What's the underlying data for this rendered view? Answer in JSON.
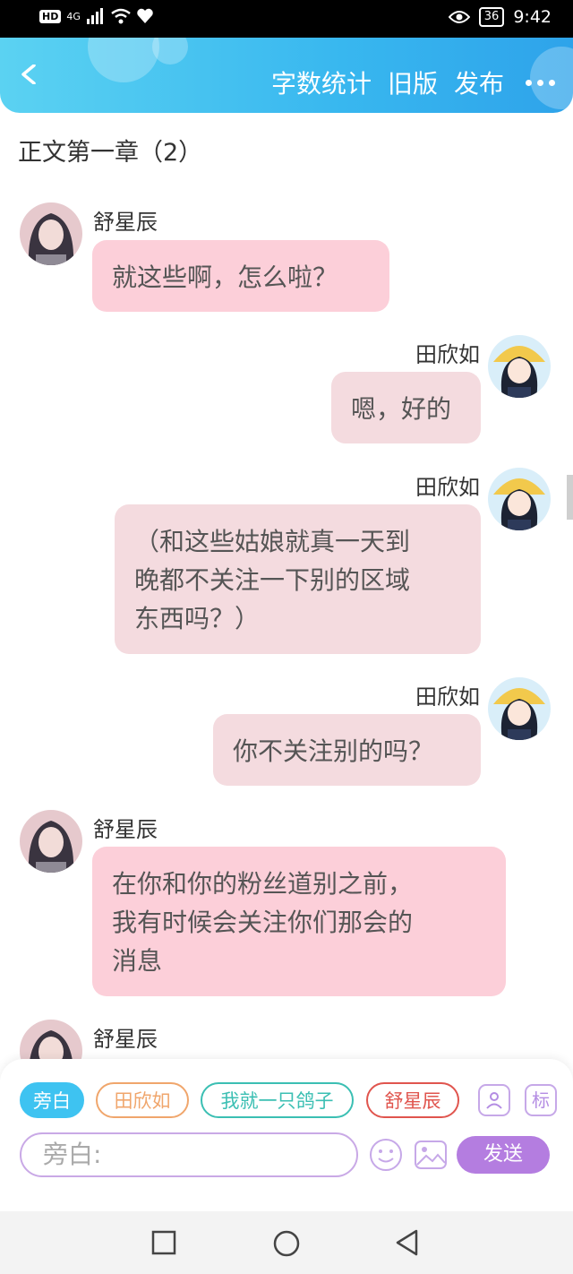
{
  "status_bar": {
    "hd": "HD",
    "network": "4G",
    "battery": "36",
    "time": "9:42"
  },
  "header": {
    "actions": [
      "字数统计",
      "旧版",
      "发布"
    ],
    "colors": {
      "gradient_start": "#5bd2f2",
      "gradient_end": "#2ea3ea"
    }
  },
  "chapter_title": "正文第一章（2）",
  "messages": [
    {
      "side": "left",
      "name": "舒星辰",
      "text_lines": [
        "就这些啊，怎么啦？"
      ]
    },
    {
      "side": "right",
      "name": "田欣如",
      "text_lines": [
        "嗯，好的"
      ]
    },
    {
      "side": "right",
      "name": "田欣如",
      "text_lines": [
        "（和这些姑娘就真一天到",
        "晚都不关注一下别的区域",
        "东西吗？）"
      ]
    },
    {
      "side": "right",
      "name": "田欣如",
      "text_lines": [
        "你不关注别的吗？"
      ]
    },
    {
      "side": "left",
      "name": "舒星辰",
      "text_lines": [
        "在你和你的粉丝道别之前，",
        "我有时候会关注你们那会的",
        "消息"
      ]
    },
    {
      "side": "left",
      "name": "舒星辰",
      "text_lines": []
    }
  ],
  "compose": {
    "characters": [
      "旁白",
      "田欣如",
      "我就一只鸽子",
      "舒星辰"
    ],
    "character_colors": [
      "#3ec3f1",
      "#f0a66c",
      "#3bbfb3",
      "#e0554e"
    ],
    "icon_label": "标",
    "placeholder": "旁白:",
    "send_label": "发送"
  },
  "icons": [
    "back-icon",
    "more-icon",
    "person-card-icon",
    "tag-icon",
    "emoji-icon",
    "image-icon",
    "recent-apps-icon",
    "home-icon",
    "nav-back-icon"
  ]
}
